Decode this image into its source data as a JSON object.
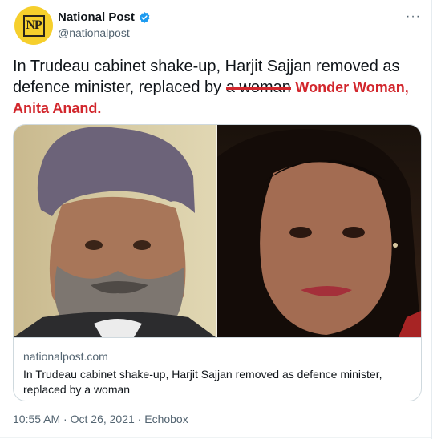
{
  "header": {
    "display_name": "National Post",
    "handle": "@nationalpost",
    "avatar_text": "NP",
    "more_label": "···"
  },
  "tweet": {
    "text_before": "In Trudeau cabinet shake-up, Harjit Sajjan removed as defence minister, replaced by ",
    "struck_text": "a woman",
    "annotation": "Wonder Woman, Anita Anand."
  },
  "card": {
    "domain": "nationalpost.com",
    "title": "In Trudeau cabinet shake-up, Harjit Sajjan removed as defence minister, replaced by a woman"
  },
  "meta": {
    "time": "10:55 AM",
    "date": "Oct 26, 2021",
    "source": "Echobox",
    "separator": "·"
  },
  "colors": {
    "verified": "#1d9bf0",
    "annotation": "#d2272d",
    "avatar_bg": "#f6cf2c"
  }
}
